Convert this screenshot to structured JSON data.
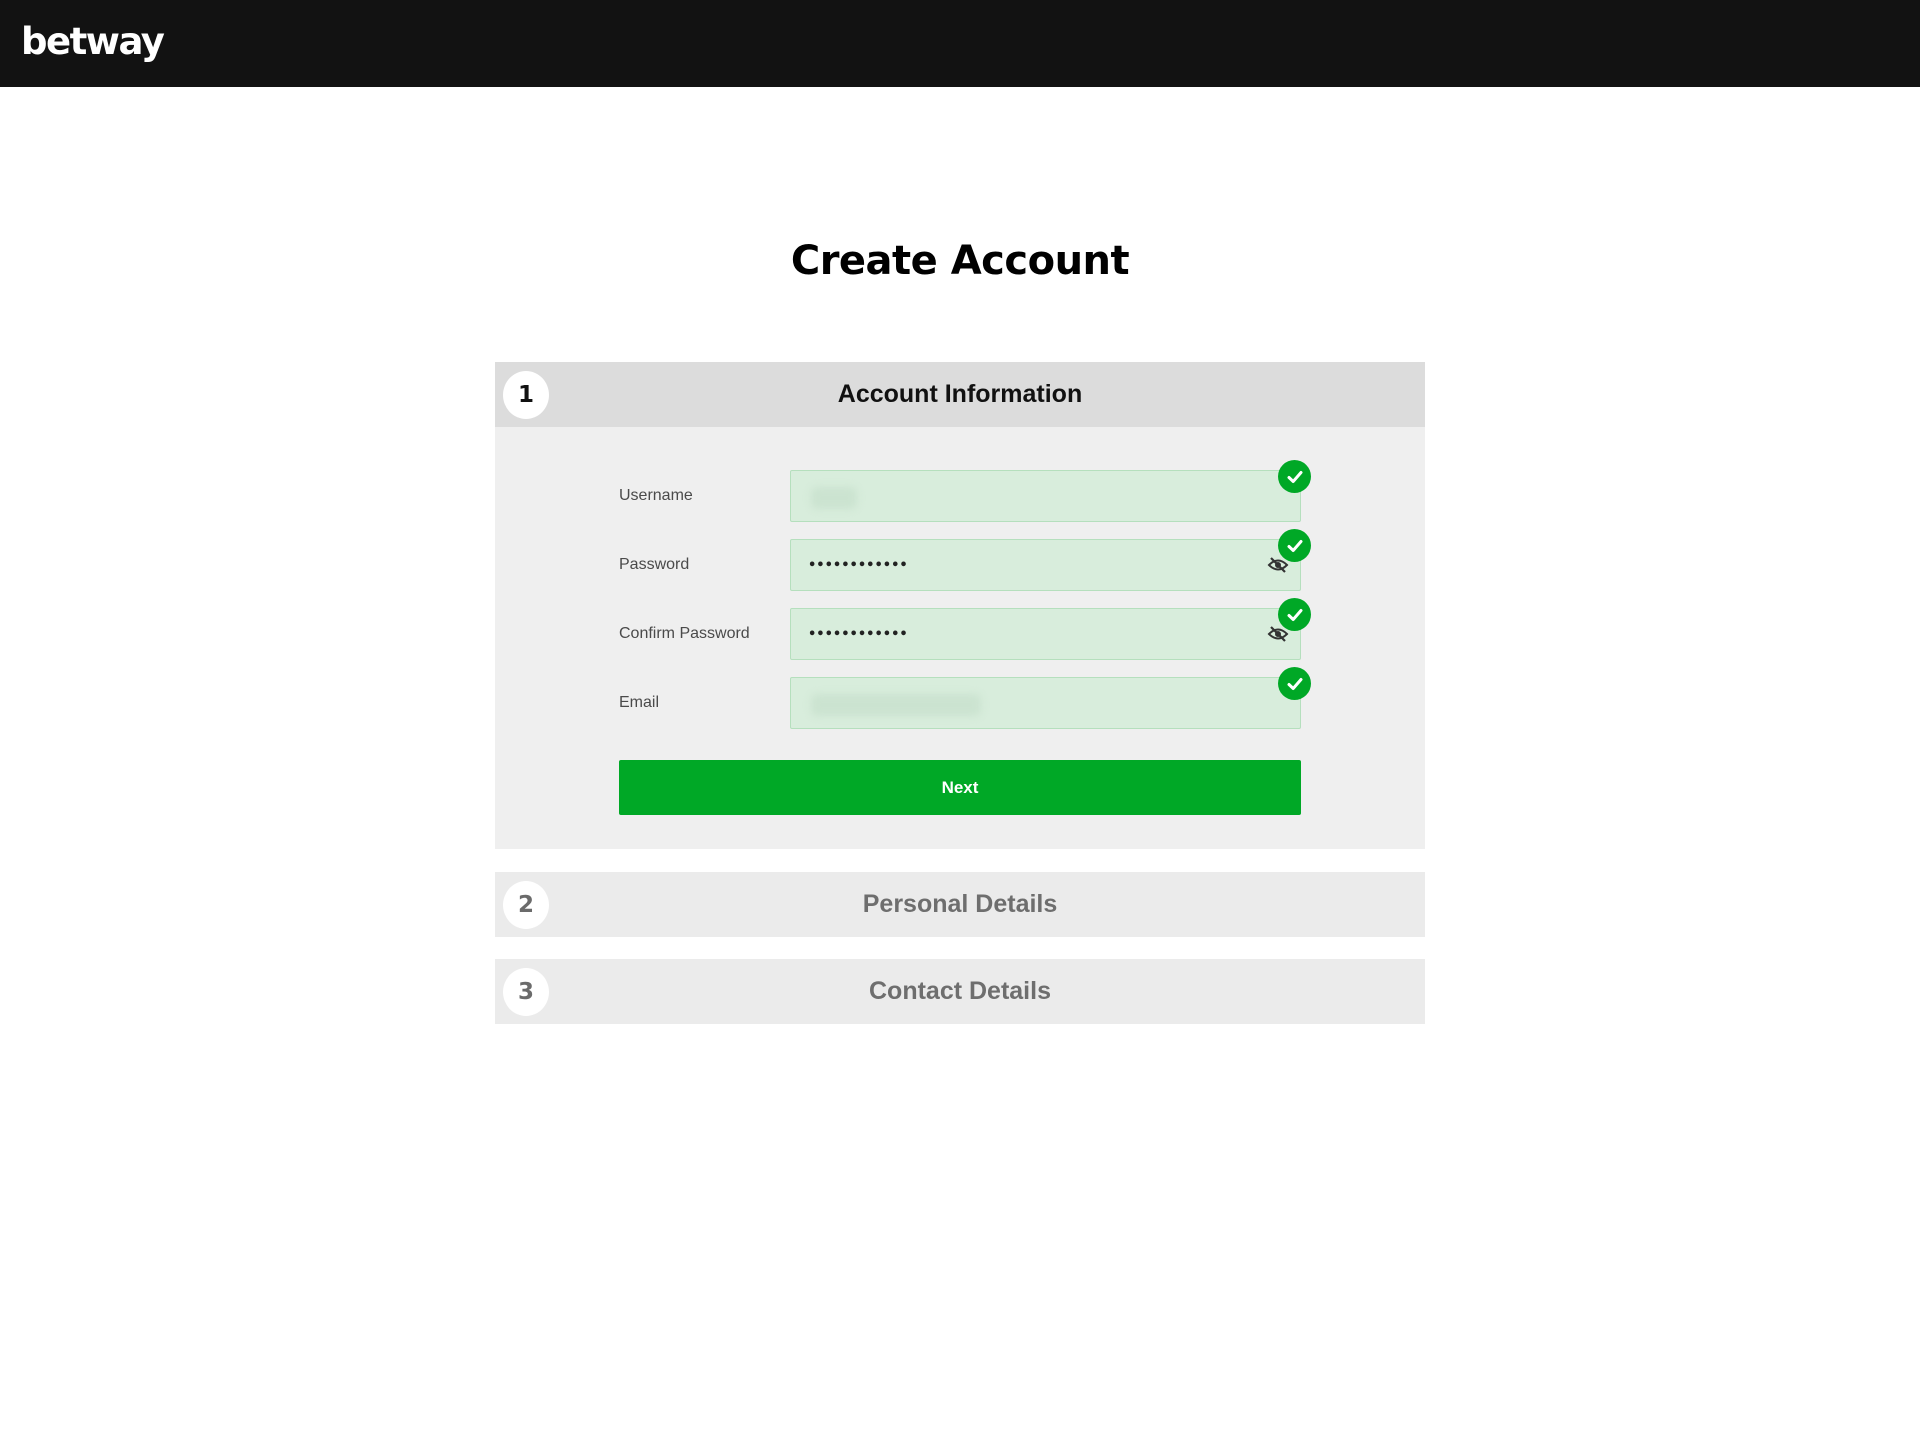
{
  "header": {
    "logo_text": "betway"
  },
  "page": {
    "title": "Create Account"
  },
  "steps": [
    {
      "number": "1",
      "title": "Account Information",
      "state": "active",
      "fields": [
        {
          "label": "Username",
          "value": "",
          "value_obscured": true,
          "type": "text",
          "valid": true,
          "check_icon": "check-circle-icon"
        },
        {
          "label": "Password",
          "value": "••••••••••••",
          "type": "password",
          "valid": true,
          "check_icon": "check-circle-icon",
          "toggle_icon": "eye-slash-icon"
        },
        {
          "label": "Confirm Password",
          "value": "••••••••••••",
          "type": "password",
          "valid": true,
          "check_icon": "check-circle-icon",
          "toggle_icon": "eye-slash-icon"
        },
        {
          "label": "Email",
          "value": "",
          "value_obscured": true,
          "type": "email",
          "valid": true,
          "check_icon": "check-circle-icon"
        }
      ],
      "next_label": "Next"
    },
    {
      "number": "2",
      "title": "Personal Details",
      "state": "inactive"
    },
    {
      "number": "3",
      "title": "Contact Details",
      "state": "inactive"
    }
  ],
  "colors": {
    "topbar": "#121212",
    "accent_green": "#00a826",
    "valid_field_bg": "#d8eddc",
    "active_step_header": "#dcdcdc",
    "inactive_step_header": "#ebebeb",
    "step_body": "#efefef"
  }
}
